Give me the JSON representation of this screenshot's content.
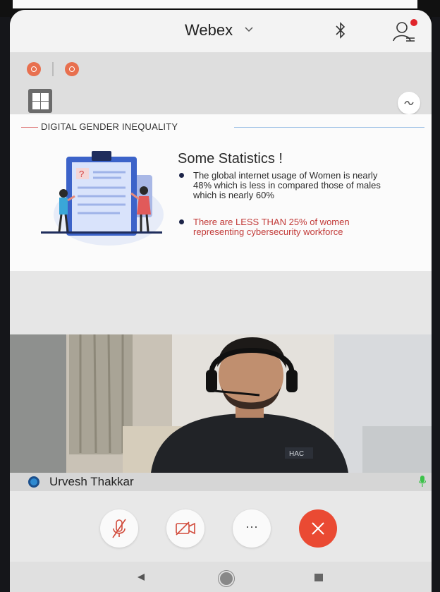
{
  "header": {
    "app_title": "Webex",
    "icons": [
      "chevron-down-icon",
      "bluetooth-icon",
      "participants-icon"
    ],
    "notification_dot_color": "#e0242a"
  },
  "meeting_bar": {
    "indicator_color": "#e8704f",
    "grid_icon": "grid-layout-icon",
    "swap_icon": "swap-video-icon"
  },
  "shared_slide": {
    "section_heading": "DIGITAL GENDER INEQUALITY",
    "stats_title": "Some Statistics !",
    "illustration_badge": "?",
    "stats": [
      {
        "text": "The global internet usage of Women is nearly 48% which is less in compared those of males which is nearly 60%",
        "color": "#2c2c2c"
      },
      {
        "text": "There are LESS THAN 25% of women representing cybersecurity workforce",
        "color": "#c23a38"
      }
    ]
  },
  "participant": {
    "name": "Urvesh Thakkar",
    "shirt_logo": "HAC"
  },
  "controls": {
    "buttons": [
      "mute-icon",
      "video-off-icon",
      "more-icon",
      "end-call-icon"
    ],
    "more_label": "···",
    "end_color": "#ea4a33"
  },
  "navbar": {
    "icons": [
      "back-icon",
      "home-icon",
      "recents-icon"
    ]
  }
}
